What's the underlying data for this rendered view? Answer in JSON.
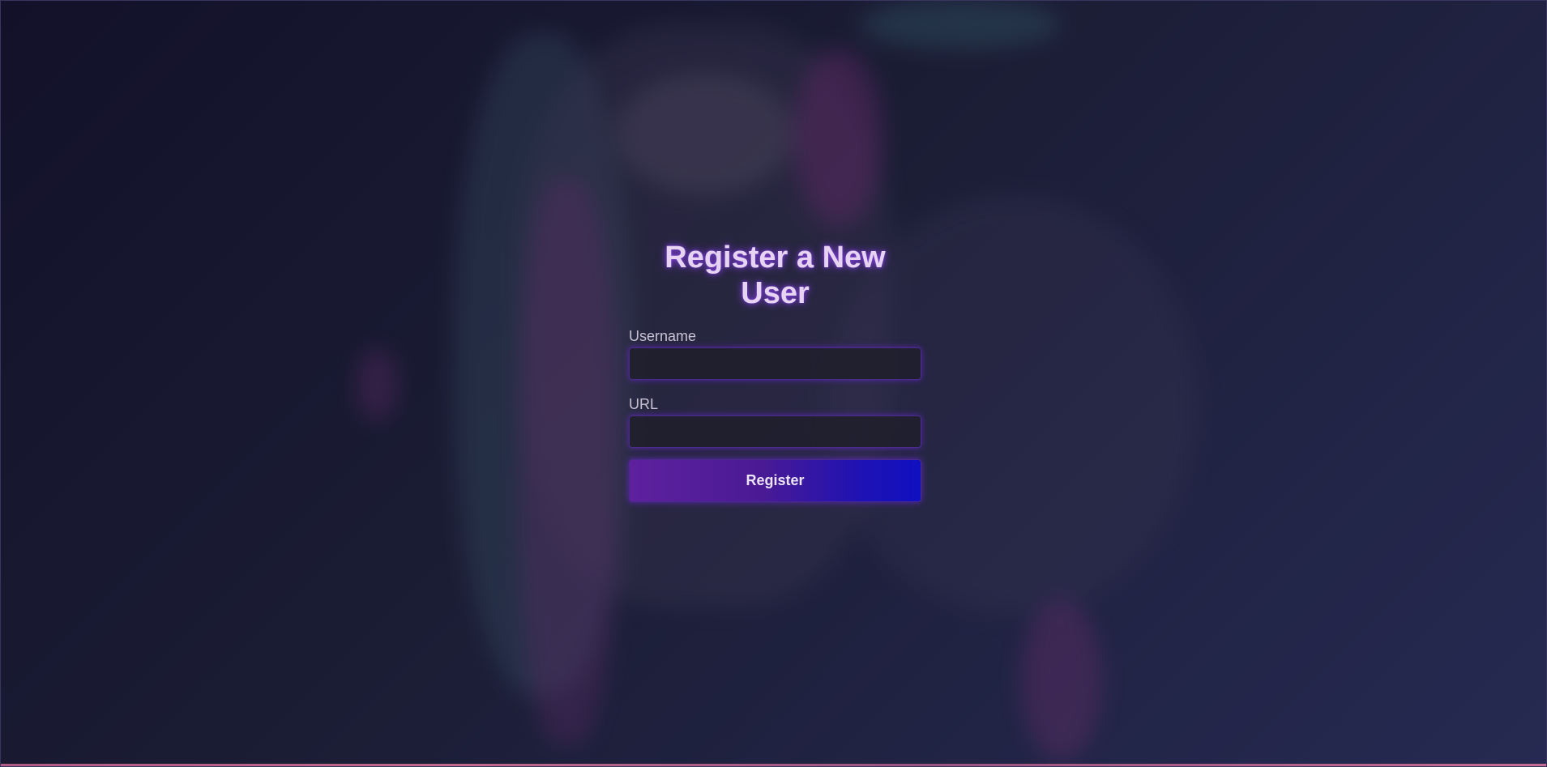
{
  "page": {
    "title": "Register a New User"
  },
  "form": {
    "username_label": "Username",
    "username_value": "",
    "url_label": "URL",
    "url_value": "",
    "submit_label": "Register"
  },
  "colors": {
    "title_text": "#e6d4f2",
    "title_glow": "#9646ff",
    "button_gradient_start": "#5e219e",
    "button_gradient_end": "#1010c0",
    "input_border": "#4a2b8c"
  }
}
